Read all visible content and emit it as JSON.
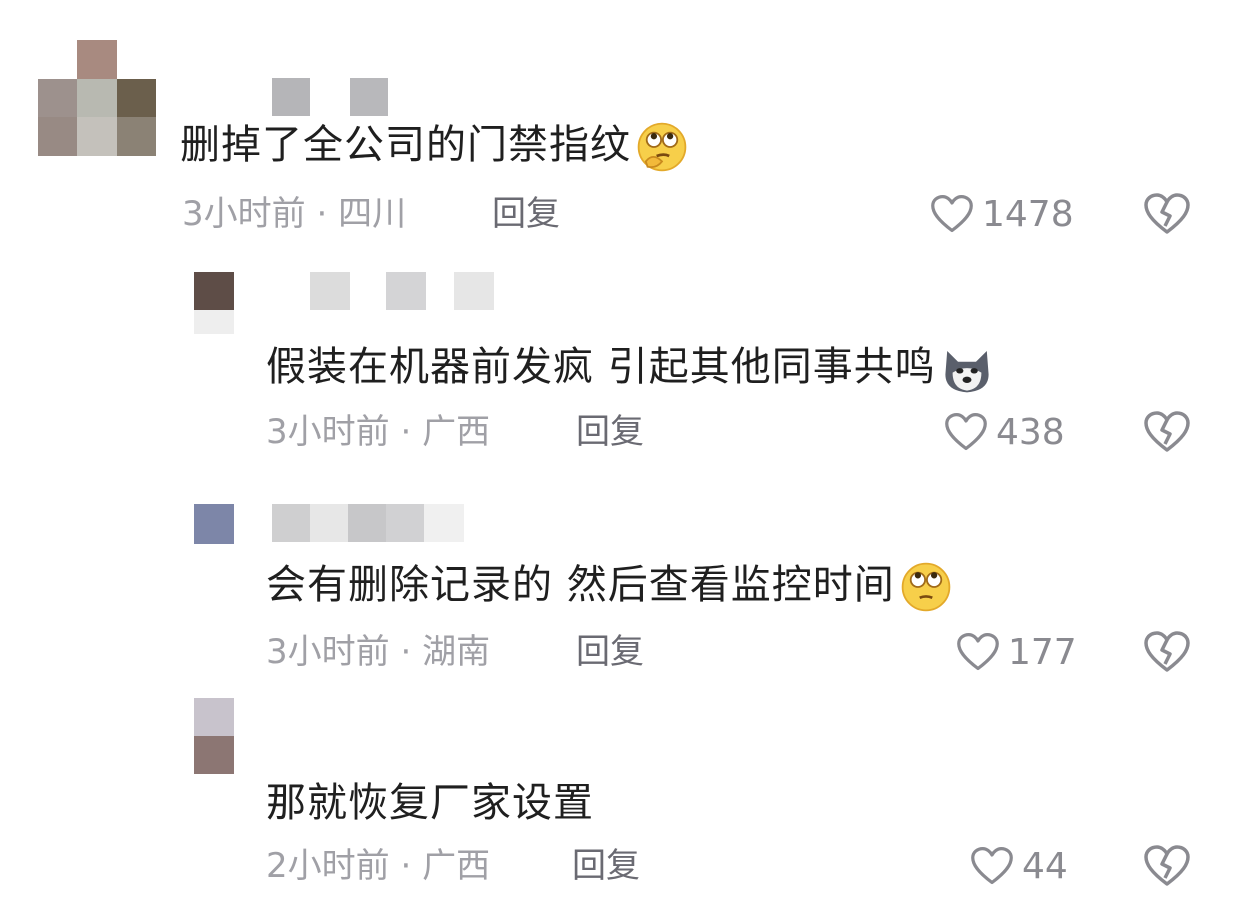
{
  "comments": [
    {
      "text": "删掉了全公司的门禁指纹",
      "emoji": "thinking-face-emoji",
      "time": "3小时前",
      "location": "四川",
      "reply_label": "回复",
      "likes": "1478"
    },
    {
      "text": "假装在机器前发疯 引起其他同事共鸣",
      "emoji": "husky-dog-emoji",
      "time": "3小时前",
      "location": "广西",
      "reply_label": "回复",
      "likes": "438"
    },
    {
      "text": "会有删除记录的 然后查看监控时间",
      "emoji": "eye-roll-face-emoji",
      "time": "3小时前",
      "location": "湖南",
      "reply_label": "回复",
      "likes": "177"
    },
    {
      "text": "那就恢复厂家设置",
      "emoji": "",
      "time": "2小时前",
      "location": "广西",
      "reply_label": "回复",
      "likes": "44"
    }
  ],
  "separator": "·",
  "colors": {
    "meta": "#a0a0a6",
    "text": "#1f1f1f",
    "icon": "#8a8a90"
  }
}
